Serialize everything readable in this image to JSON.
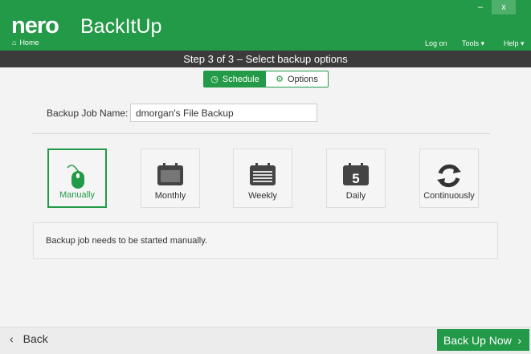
{
  "header": {
    "logo": "nero",
    "product": "BackItUp",
    "home": "Home",
    "minimize": "–",
    "close": "x",
    "menu": [
      "Log on",
      "Tools ▾",
      "Help ▾"
    ]
  },
  "step": "Step 3 of 3 – Select backup options",
  "tabs": [
    "Schedule",
    "Options"
  ],
  "job": {
    "label": "Backup Job Name:",
    "value": "dmorgan's File Backup"
  },
  "schedules": [
    "Manually",
    "Monthly",
    "Weekly",
    "Daily",
    "Continuously"
  ],
  "daily_number": "5",
  "message": "Backup job needs to be started manually.",
  "footer": {
    "back": "Back",
    "back_icon": "‹",
    "next": "Back Up Now",
    "next_icon": "›"
  },
  "colors": {
    "accent": "#229a47",
    "bar": "#3b3b3b"
  }
}
